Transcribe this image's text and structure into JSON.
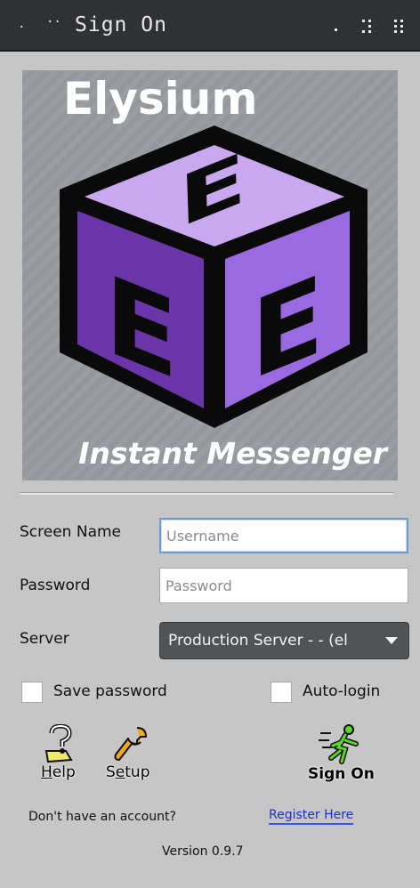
{
  "window": {
    "title": "Sign On"
  },
  "logo": {
    "title": "Elysium",
    "subtitle": "Instant Messenger",
    "cube_letter": "E",
    "colors": {
      "top": "#c8a8ee",
      "left": "#6a35a8",
      "right": "#9a6ae0",
      "edge": "#0a0a0a"
    }
  },
  "form": {
    "screen_name_label": "Screen Name",
    "username_placeholder": "Username",
    "username_value": "",
    "password_label": "Password",
    "password_placeholder": "Password",
    "password_value": "",
    "server_label": "Server",
    "server_selected": "Production Server - - (el",
    "save_password_label": "Save password",
    "save_password_checked": false,
    "auto_login_label": "Auto-login",
    "auto_login_checked": false
  },
  "tools": {
    "help_label": "Help",
    "help_accel": "H",
    "help_rest": "elp",
    "setup_label": "Setup",
    "setup_pre": "S",
    "setup_accel": "e",
    "setup_rest": "tup",
    "sign_on_label": "Sign On"
  },
  "footer": {
    "no_account_text": "Don't have an account?",
    "register_link": "Register Here",
    "version": "Version 0.9.7"
  },
  "icons": {
    "help": "help-icon",
    "setup": "wrench-icon",
    "sign_on": "running-man-icon"
  }
}
